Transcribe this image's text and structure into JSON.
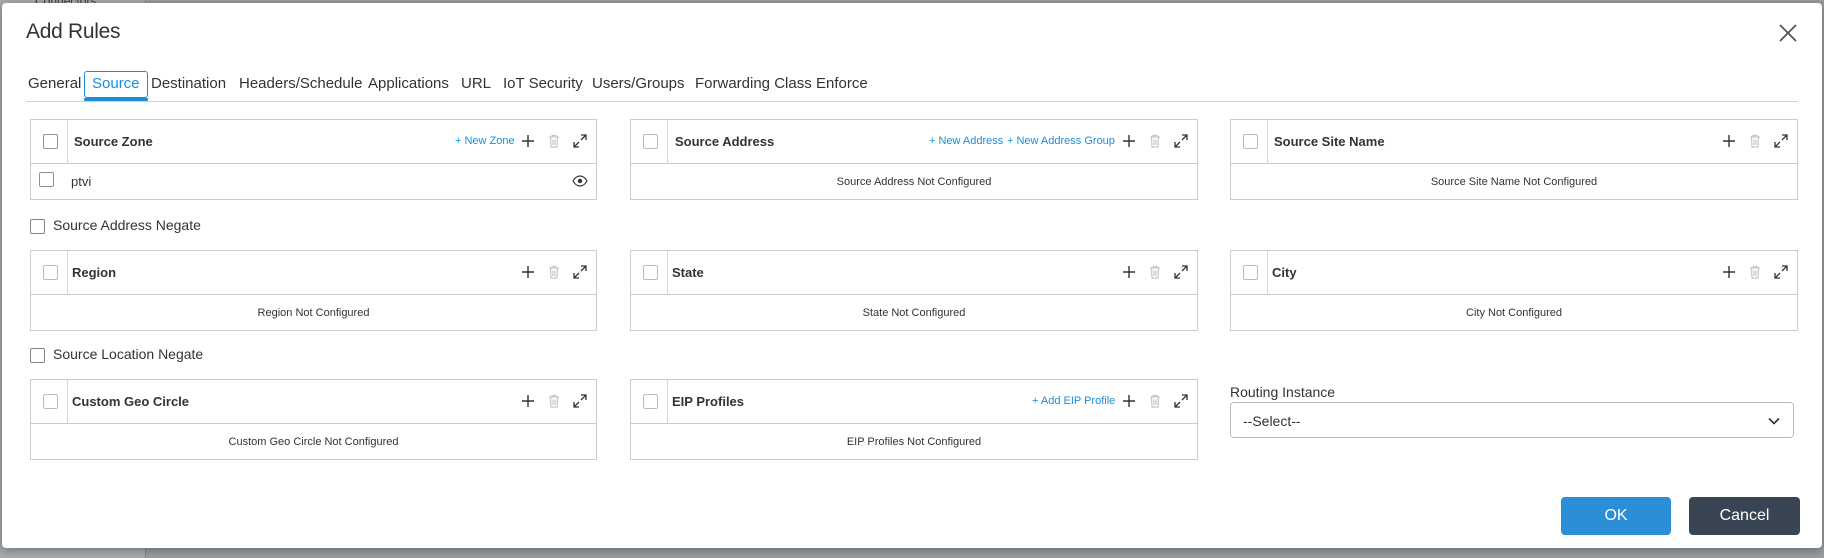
{
  "background": {
    "sidebar_text": "Connectors"
  },
  "dialog": {
    "title": "Add Rules",
    "close_icon": "close-icon"
  },
  "tabs": [
    {
      "label": "General"
    },
    {
      "label": "Source",
      "active": true
    },
    {
      "label": "Destination"
    },
    {
      "label": "Headers/Schedule"
    },
    {
      "label": "Applications"
    },
    {
      "label": "URL"
    },
    {
      "label": "IoT Security"
    },
    {
      "label": "Users/Groups"
    },
    {
      "label": "Forwarding Class"
    },
    {
      "label": "Enforce"
    }
  ],
  "panels": {
    "source_zone": {
      "title": "Source Zone",
      "link1": "+ New Zone",
      "rows": [
        {
          "name": "ptvi"
        }
      ]
    },
    "source_address": {
      "title": "Source Address",
      "link1": "+ New Address",
      "link2": "+ New Address Group",
      "empty": "Source Address Not Configured"
    },
    "source_site_name": {
      "title": "Source Site Name",
      "empty": "Source Site Name Not Configured"
    },
    "region": {
      "title": "Region",
      "empty": "Region Not Configured"
    },
    "state": {
      "title": "State",
      "empty": "State Not Configured"
    },
    "city": {
      "title": "City",
      "empty": "City Not Configured"
    },
    "custom_geo_circle": {
      "title": "Custom Geo Circle",
      "empty": "Custom Geo Circle Not Configured"
    },
    "eip_profiles": {
      "title": "EIP Profiles",
      "link1": "+ Add EIP Profile",
      "empty": "EIP Profiles Not Configured"
    }
  },
  "negate": {
    "source_address": "Source Address Negate",
    "source_location": "Source Location Negate"
  },
  "routing_instance": {
    "label": "Routing Instance",
    "value": "--Select--"
  },
  "buttons": {
    "ok": "OK",
    "cancel": "Cancel"
  },
  "colors": {
    "accent": "#1a8fd6",
    "ok_button": "#2b8fd8",
    "cancel_button": "#3a4553"
  }
}
